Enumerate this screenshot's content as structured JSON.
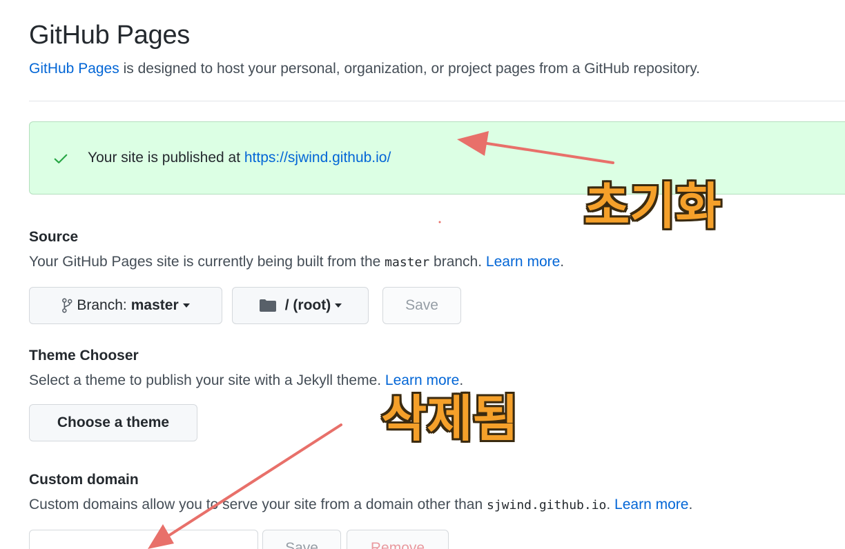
{
  "page": {
    "title": "GitHub Pages",
    "intro_link": "GitHub Pages",
    "intro_text": " is designed to host your personal, organization, or project pages from a GitHub repository."
  },
  "flash": {
    "icon": "check-icon",
    "text": "Your site is published at ",
    "url": "https://sjwind.github.io/",
    "color": "#dcffe4"
  },
  "source": {
    "title": "Source",
    "desc_before": "Your GitHub Pages site is currently being built from the ",
    "branch_code": "master",
    "desc_after": " branch. ",
    "learn_more": "Learn more",
    "period": ".",
    "branch_button_prefix": "Branch: ",
    "branch_button_value": "master",
    "folder_button": "/ (root)",
    "save_button": "Save"
  },
  "theme": {
    "title": "Theme Chooser",
    "desc": "Select a theme to publish your site with a Jekyll theme. ",
    "learn_more": "Learn more",
    "period": ".",
    "button": "Choose a theme"
  },
  "custom_domain": {
    "title": "Custom domain",
    "desc_before": "Custom domains allow you to serve your site from a domain other than ",
    "domain_code": "sjwind.github.io",
    "desc_after": ". ",
    "learn_more": "Learn more",
    "period": ".",
    "input_value": "",
    "save_button": "Save",
    "remove_button": "Remove"
  },
  "annotations": {
    "top": "초기화",
    "middle": "삭제됨",
    "color": "#f5a02a",
    "arrow_color": "#e8706a"
  }
}
